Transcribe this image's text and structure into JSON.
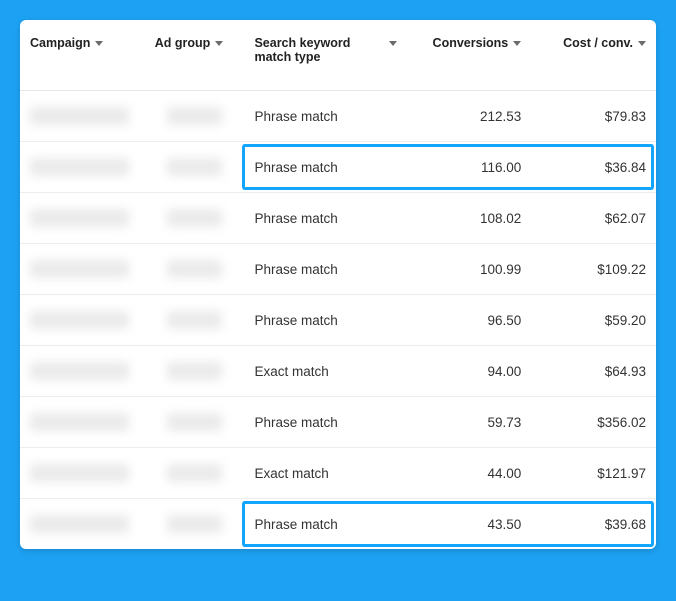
{
  "columns": {
    "campaign": "Campaign",
    "adgroup": "Ad group",
    "matchtype": "Search keyword match type",
    "conversions": "Conversions",
    "costperconv": "Cost / conv."
  },
  "rows": [
    {
      "match_type": "Phrase match",
      "conversions": "212.53",
      "cost_per_conv": "$79.83",
      "highlighted": false
    },
    {
      "match_type": "Phrase match",
      "conversions": "116.00",
      "cost_per_conv": "$36.84",
      "highlighted": true
    },
    {
      "match_type": "Phrase match",
      "conversions": "108.02",
      "cost_per_conv": "$62.07",
      "highlighted": false
    },
    {
      "match_type": "Phrase match",
      "conversions": "100.99",
      "cost_per_conv": "$109.22",
      "highlighted": false
    },
    {
      "match_type": "Phrase match",
      "conversions": "96.50",
      "cost_per_conv": "$59.20",
      "highlighted": false
    },
    {
      "match_type": "Exact match",
      "conversions": "94.00",
      "cost_per_conv": "$64.93",
      "highlighted": false
    },
    {
      "match_type": "Phrase match",
      "conversions": "59.73",
      "cost_per_conv": "$356.02",
      "highlighted": false
    },
    {
      "match_type": "Exact match",
      "conversions": "44.00",
      "cost_per_conv": "$121.97",
      "highlighted": false
    },
    {
      "match_type": "Phrase match",
      "conversions": "43.50",
      "cost_per_conv": "$39.68",
      "highlighted": true
    }
  ]
}
